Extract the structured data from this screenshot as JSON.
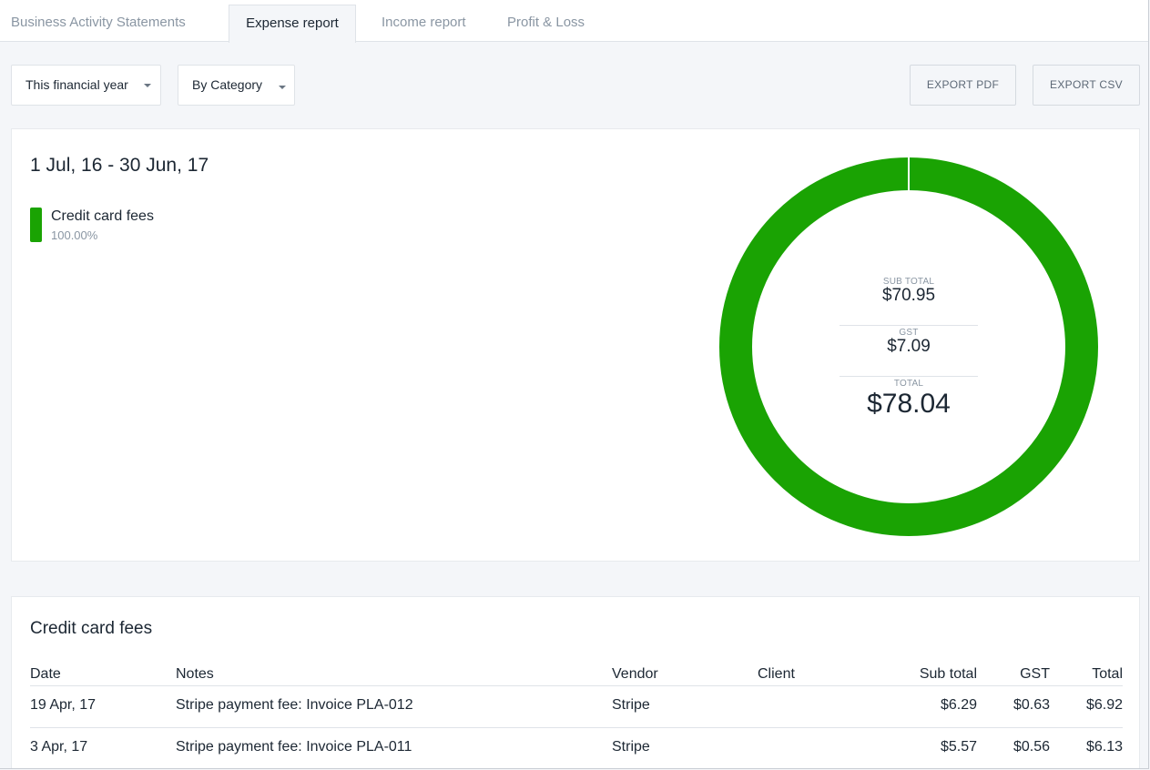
{
  "tabs": [
    {
      "label": "Business Activity Statements",
      "active": false
    },
    {
      "label": "Expense report",
      "active": true
    },
    {
      "label": "Income report",
      "active": false
    },
    {
      "label": "Profit & Loss",
      "active": false
    }
  ],
  "toolbar": {
    "period_select": "This financial year",
    "group_select": "By Category",
    "export_pdf": "EXPORT PDF",
    "export_csv": "EXPORT CSV"
  },
  "summary": {
    "date_range": "1 Jul, 16 - 30 Jun, 17",
    "legend": [
      {
        "label": "Credit card fees",
        "percent": "100.00%",
        "color": "#1aa303"
      }
    ],
    "subtotal_label": "SUB TOTAL",
    "subtotal": "$70.95",
    "gst_label": "GST",
    "gst": "$7.09",
    "total_label": "TOTAL",
    "total": "$78.04"
  },
  "chart_data": {
    "type": "pie",
    "categories": [
      "Credit card fees"
    ],
    "values": [
      100.0
    ],
    "donut": true,
    "colors": [
      "#1aa303"
    ]
  },
  "table": {
    "title": "Credit card fees",
    "headers": {
      "date": "Date",
      "notes": "Notes",
      "vendor": "Vendor",
      "client": "Client",
      "subtotal": "Sub total",
      "gst": "GST",
      "total": "Total"
    },
    "rows": [
      {
        "date": "19 Apr, 17",
        "notes": "Stripe payment fee: Invoice PLA-012",
        "vendor": "Stripe",
        "client": "",
        "subtotal": "$6.29",
        "gst": "$0.63",
        "total": "$6.92"
      },
      {
        "date": "3 Apr, 17",
        "notes": "Stripe payment fee: Invoice PLA-011",
        "vendor": "Stripe",
        "client": "",
        "subtotal": "$5.57",
        "gst": "$0.56",
        "total": "$6.13"
      }
    ]
  }
}
